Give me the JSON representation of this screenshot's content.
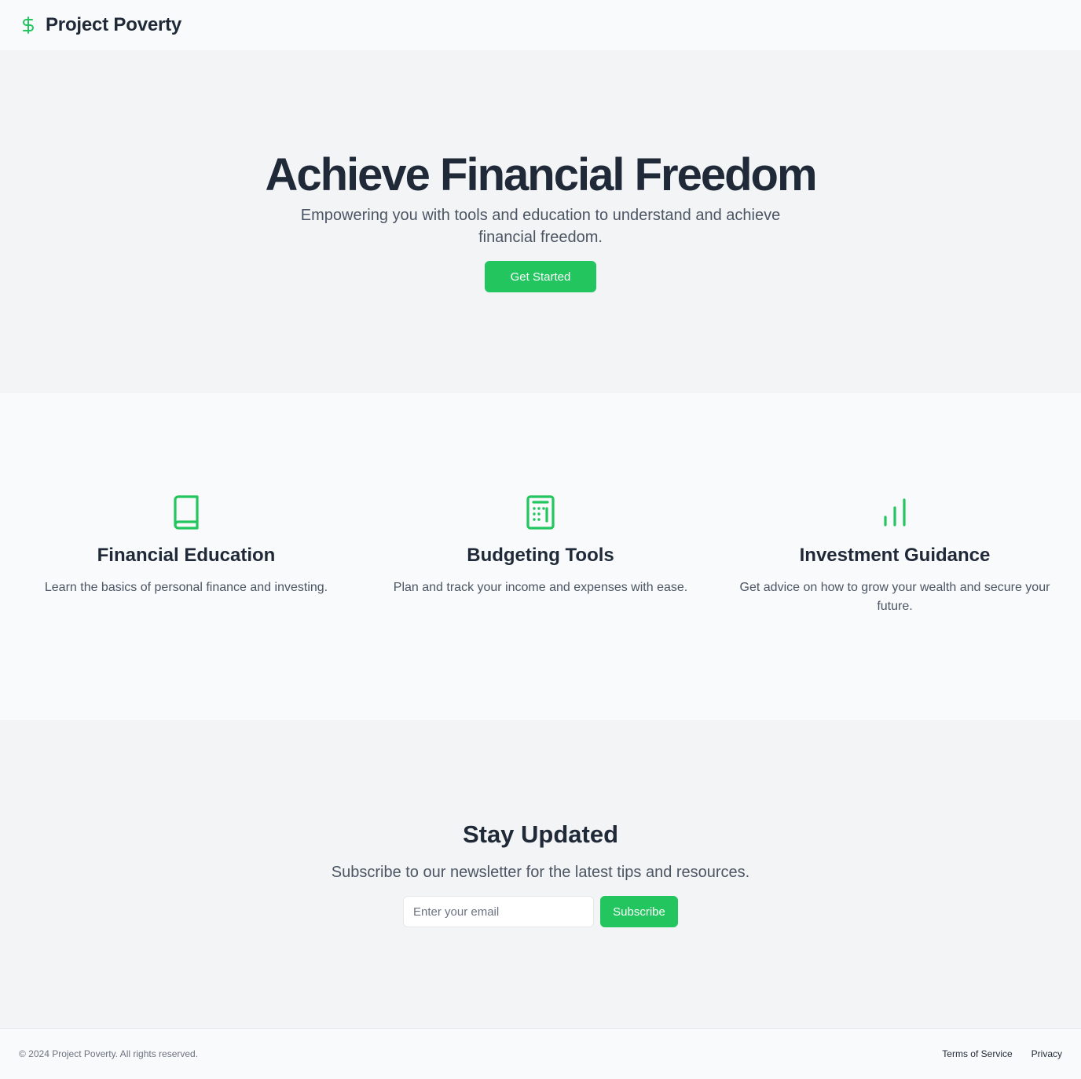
{
  "colors": {
    "accent": "#22c55e",
    "text_dark": "#1f2937",
    "text_muted": "#4b5563",
    "bg_light": "#f9fafb",
    "bg_section": "#f3f4f6"
  },
  "header": {
    "brand_icon": "dollar-icon",
    "brand_name": "Project Poverty"
  },
  "hero": {
    "title": "Achieve Financial Freedom",
    "subtitle": "Empowering you with tools and education to understand and achieve financial freedom.",
    "cta_label": "Get Started"
  },
  "features": [
    {
      "icon": "book-icon",
      "title": "Financial Education",
      "text": "Learn the basics of personal finance and investing."
    },
    {
      "icon": "calculator-icon",
      "title": "Budgeting Tools",
      "text": "Plan and track your income and expenses with ease."
    },
    {
      "icon": "bar-chart-icon",
      "title": "Investment Guidance",
      "text": "Get advice on how to grow your wealth and secure your future."
    }
  ],
  "newsletter": {
    "title": "Stay Updated",
    "subtitle": "Subscribe to our newsletter for the latest tips and resources.",
    "email_placeholder": "Enter your email",
    "email_value": "",
    "subscribe_label": "Subscribe"
  },
  "footer": {
    "copyright": "© 2024 Project Poverty. All rights reserved.",
    "links": [
      {
        "label": "Terms of Service"
      },
      {
        "label": "Privacy"
      }
    ]
  }
}
